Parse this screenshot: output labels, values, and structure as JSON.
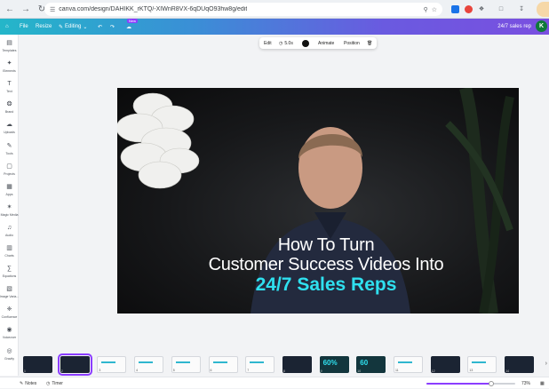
{
  "browser": {
    "url": "canva.com/design/DAHIKK_rKTQ/-XIWnR8VX-6qDUqO93hw8g/edit",
    "back_icon": "arrow-left-icon",
    "forward_icon": "arrow-right-icon",
    "reload_icon": "reload-icon"
  },
  "header": {
    "file_label": "File",
    "resize_label": "Resize",
    "editing_label": "Editing",
    "new_badge": "New",
    "doc_title": "24/7 sales rep",
    "avatar_initial": "K",
    "gradient_colors": [
      "#24b6c9",
      "#6a5ae0"
    ]
  },
  "sidebar": {
    "items": [
      {
        "label": "Templates",
        "icon": "template-icon"
      },
      {
        "label": "Elements",
        "icon": "elements-icon"
      },
      {
        "label": "Text",
        "icon": "text-icon"
      },
      {
        "label": "Brand",
        "icon": "brand-icon"
      },
      {
        "label": "Uploads",
        "icon": "upload-icon"
      },
      {
        "label": "Tools",
        "icon": "tools-icon"
      },
      {
        "label": "Projects",
        "icon": "folder-icon"
      },
      {
        "label": "Apps",
        "icon": "apps-icon"
      },
      {
        "label": "Magic Media",
        "icon": "magic-media-icon"
      },
      {
        "label": "Audio",
        "icon": "audio-icon"
      },
      {
        "label": "Charts",
        "icon": "chart-icon"
      },
      {
        "label": "Equations",
        "icon": "equation-icon"
      },
      {
        "label": "Image Varia...",
        "icon": "image-variation-icon"
      },
      {
        "label": "Confluence",
        "icon": "confluence-icon"
      },
      {
        "label": "Voiceover",
        "icon": "voiceover-icon"
      },
      {
        "label": "Gravity",
        "icon": "gravity-icon"
      }
    ]
  },
  "context_toolbar": {
    "edit_label": "Edit",
    "duration_label": "5.0s",
    "animate_label": "Animate",
    "position_label": "Position"
  },
  "canvas": {
    "line1": "How To Turn",
    "line2": "Customer Success Videos Into",
    "line3": "24/7 Sales Reps",
    "accent_color": "#2fe0ef"
  },
  "pages": {
    "thumbnails": [
      {
        "num": "1",
        "style": "dark",
        "selected": false,
        "text": ""
      },
      {
        "num": "2",
        "style": "dark",
        "selected": true,
        "text": ""
      },
      {
        "num": "3",
        "style": "light",
        "selected": false,
        "text": ""
      },
      {
        "num": "4",
        "style": "light",
        "selected": false,
        "text": ""
      },
      {
        "num": "5",
        "style": "light",
        "selected": false,
        "text": ""
      },
      {
        "num": "6",
        "style": "light",
        "selected": false,
        "text": ""
      },
      {
        "num": "7",
        "style": "light",
        "selected": false,
        "text": ""
      },
      {
        "num": "8",
        "style": "dark",
        "selected": false,
        "text": ""
      },
      {
        "num": "9",
        "style": "teal",
        "selected": false,
        "text": "60%"
      },
      {
        "num": "10",
        "style": "teal",
        "selected": false,
        "text": "60"
      },
      {
        "num": "11",
        "style": "light",
        "selected": false,
        "text": ""
      },
      {
        "num": "12",
        "style": "dark",
        "selected": false,
        "text": ""
      },
      {
        "num": "13",
        "style": "light",
        "selected": false,
        "text": ""
      },
      {
        "num": "14",
        "style": "dark",
        "selected": false,
        "text": ""
      }
    ]
  },
  "bottombar": {
    "notes_label": "Notes",
    "timer_label": "Timer",
    "zoom_label": "73%",
    "zoom_fraction": 0.73
  }
}
